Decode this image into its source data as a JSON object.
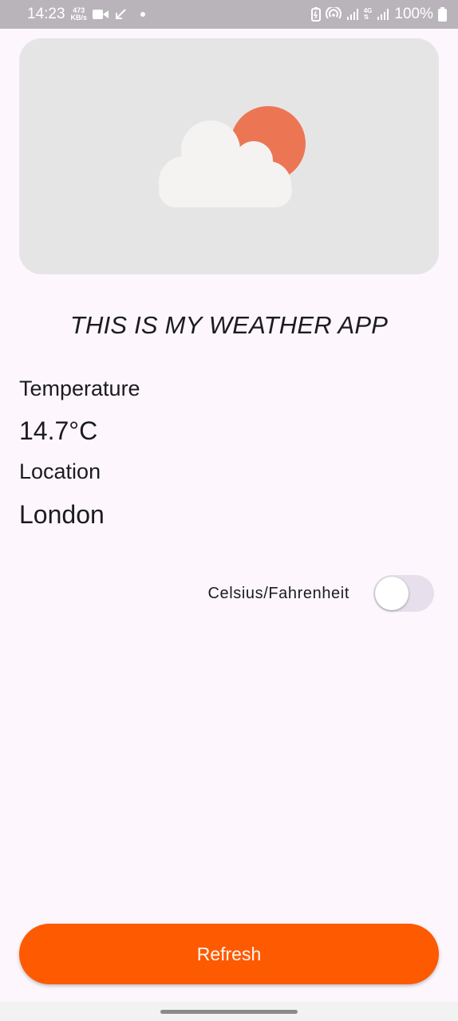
{
  "status_bar": {
    "time": "14:23",
    "speed_value": "473",
    "speed_unit": "KB/s",
    "network_type": "4G",
    "battery": "100%",
    "icons": [
      "video-icon",
      "call-arrow-icon",
      "notification-dot-icon",
      "battery-saver-icon",
      "hotspot-icon",
      "signal-icon",
      "battery-icon"
    ]
  },
  "hero": {
    "icon": "partly-cloudy-icon",
    "sun_color": "#ec7654",
    "cloud_color": "#f4f3f2",
    "background_color": "#e6e5e6"
  },
  "app": {
    "title": "THIS IS MY WEATHER APP"
  },
  "weather": {
    "temperature_label": "Temperature",
    "temperature_value": "14.7°C",
    "location_label": "Location",
    "location_value": "London"
  },
  "units_toggle": {
    "label": "Celsius/Fahrenheit",
    "checked": false
  },
  "actions": {
    "refresh_label": "Refresh",
    "accent_color": "#fd5a01"
  }
}
